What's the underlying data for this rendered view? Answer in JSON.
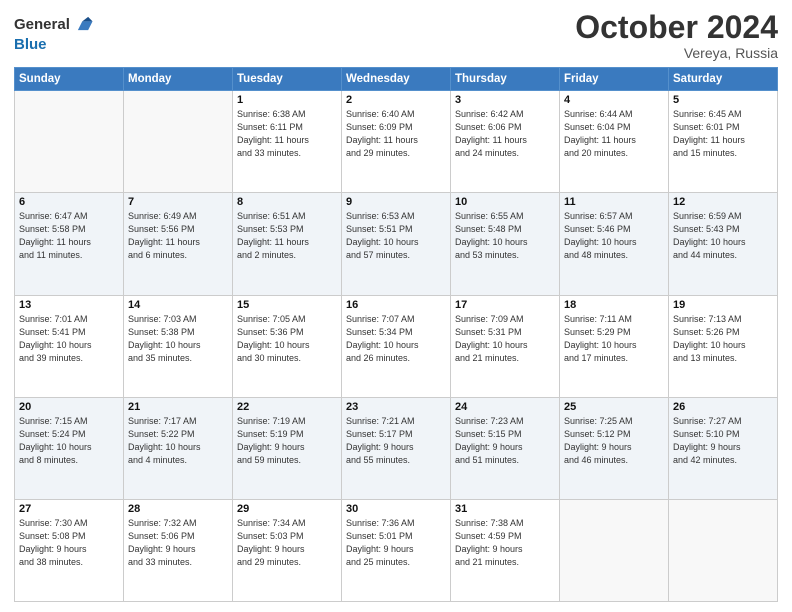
{
  "header": {
    "logo_line1": "General",
    "logo_line2": "Blue",
    "month": "October 2024",
    "location": "Vereya, Russia"
  },
  "weekdays": [
    "Sunday",
    "Monday",
    "Tuesday",
    "Wednesday",
    "Thursday",
    "Friday",
    "Saturday"
  ],
  "weeks": [
    [
      {
        "day": "",
        "detail": ""
      },
      {
        "day": "",
        "detail": ""
      },
      {
        "day": "1",
        "detail": "Sunrise: 6:38 AM\nSunset: 6:11 PM\nDaylight: 11 hours\nand 33 minutes."
      },
      {
        "day": "2",
        "detail": "Sunrise: 6:40 AM\nSunset: 6:09 PM\nDaylight: 11 hours\nand 29 minutes."
      },
      {
        "day": "3",
        "detail": "Sunrise: 6:42 AM\nSunset: 6:06 PM\nDaylight: 11 hours\nand 24 minutes."
      },
      {
        "day": "4",
        "detail": "Sunrise: 6:44 AM\nSunset: 6:04 PM\nDaylight: 11 hours\nand 20 minutes."
      },
      {
        "day": "5",
        "detail": "Sunrise: 6:45 AM\nSunset: 6:01 PM\nDaylight: 11 hours\nand 15 minutes."
      }
    ],
    [
      {
        "day": "6",
        "detail": "Sunrise: 6:47 AM\nSunset: 5:58 PM\nDaylight: 11 hours\nand 11 minutes."
      },
      {
        "day": "7",
        "detail": "Sunrise: 6:49 AM\nSunset: 5:56 PM\nDaylight: 11 hours\nand 6 minutes."
      },
      {
        "day": "8",
        "detail": "Sunrise: 6:51 AM\nSunset: 5:53 PM\nDaylight: 11 hours\nand 2 minutes."
      },
      {
        "day": "9",
        "detail": "Sunrise: 6:53 AM\nSunset: 5:51 PM\nDaylight: 10 hours\nand 57 minutes."
      },
      {
        "day": "10",
        "detail": "Sunrise: 6:55 AM\nSunset: 5:48 PM\nDaylight: 10 hours\nand 53 minutes."
      },
      {
        "day": "11",
        "detail": "Sunrise: 6:57 AM\nSunset: 5:46 PM\nDaylight: 10 hours\nand 48 minutes."
      },
      {
        "day": "12",
        "detail": "Sunrise: 6:59 AM\nSunset: 5:43 PM\nDaylight: 10 hours\nand 44 minutes."
      }
    ],
    [
      {
        "day": "13",
        "detail": "Sunrise: 7:01 AM\nSunset: 5:41 PM\nDaylight: 10 hours\nand 39 minutes."
      },
      {
        "day": "14",
        "detail": "Sunrise: 7:03 AM\nSunset: 5:38 PM\nDaylight: 10 hours\nand 35 minutes."
      },
      {
        "day": "15",
        "detail": "Sunrise: 7:05 AM\nSunset: 5:36 PM\nDaylight: 10 hours\nand 30 minutes."
      },
      {
        "day": "16",
        "detail": "Sunrise: 7:07 AM\nSunset: 5:34 PM\nDaylight: 10 hours\nand 26 minutes."
      },
      {
        "day": "17",
        "detail": "Sunrise: 7:09 AM\nSunset: 5:31 PM\nDaylight: 10 hours\nand 21 minutes."
      },
      {
        "day": "18",
        "detail": "Sunrise: 7:11 AM\nSunset: 5:29 PM\nDaylight: 10 hours\nand 17 minutes."
      },
      {
        "day": "19",
        "detail": "Sunrise: 7:13 AM\nSunset: 5:26 PM\nDaylight: 10 hours\nand 13 minutes."
      }
    ],
    [
      {
        "day": "20",
        "detail": "Sunrise: 7:15 AM\nSunset: 5:24 PM\nDaylight: 10 hours\nand 8 minutes."
      },
      {
        "day": "21",
        "detail": "Sunrise: 7:17 AM\nSunset: 5:22 PM\nDaylight: 10 hours\nand 4 minutes."
      },
      {
        "day": "22",
        "detail": "Sunrise: 7:19 AM\nSunset: 5:19 PM\nDaylight: 9 hours\nand 59 minutes."
      },
      {
        "day": "23",
        "detail": "Sunrise: 7:21 AM\nSunset: 5:17 PM\nDaylight: 9 hours\nand 55 minutes."
      },
      {
        "day": "24",
        "detail": "Sunrise: 7:23 AM\nSunset: 5:15 PM\nDaylight: 9 hours\nand 51 minutes."
      },
      {
        "day": "25",
        "detail": "Sunrise: 7:25 AM\nSunset: 5:12 PM\nDaylight: 9 hours\nand 46 minutes."
      },
      {
        "day": "26",
        "detail": "Sunrise: 7:27 AM\nSunset: 5:10 PM\nDaylight: 9 hours\nand 42 minutes."
      }
    ],
    [
      {
        "day": "27",
        "detail": "Sunrise: 7:30 AM\nSunset: 5:08 PM\nDaylight: 9 hours\nand 38 minutes."
      },
      {
        "day": "28",
        "detail": "Sunrise: 7:32 AM\nSunset: 5:06 PM\nDaylight: 9 hours\nand 33 minutes."
      },
      {
        "day": "29",
        "detail": "Sunrise: 7:34 AM\nSunset: 5:03 PM\nDaylight: 9 hours\nand 29 minutes."
      },
      {
        "day": "30",
        "detail": "Sunrise: 7:36 AM\nSunset: 5:01 PM\nDaylight: 9 hours\nand 25 minutes."
      },
      {
        "day": "31",
        "detail": "Sunrise: 7:38 AM\nSunset: 4:59 PM\nDaylight: 9 hours\nand 21 minutes."
      },
      {
        "day": "",
        "detail": ""
      },
      {
        "day": "",
        "detail": ""
      }
    ]
  ]
}
